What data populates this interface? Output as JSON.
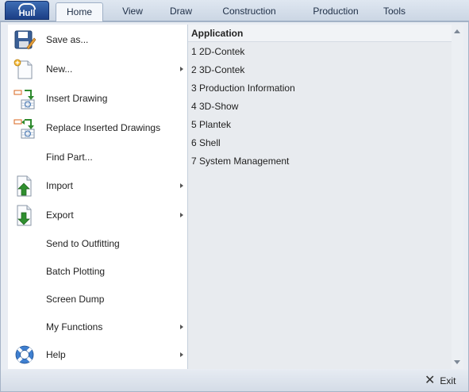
{
  "app_button": {
    "label": "Hull"
  },
  "tabs": [
    {
      "label": "Home"
    },
    {
      "label": "View"
    },
    {
      "label": "Draw"
    },
    {
      "label": "Construction"
    },
    {
      "label": "Production"
    },
    {
      "label": "Tools"
    }
  ],
  "menu": {
    "items": [
      {
        "label": "Save as...",
        "icon": "save-as-icon",
        "submenu": false
      },
      {
        "label": "New...",
        "icon": "new-document-icon",
        "submenu": true
      },
      {
        "label": "Insert Drawing",
        "icon": "insert-drawing-icon",
        "submenu": false
      },
      {
        "label": "Replace Inserted Drawings",
        "icon": "replace-drawings-icon",
        "submenu": false
      },
      {
        "label": "Find Part...",
        "icon": "",
        "submenu": false
      },
      {
        "label": "Import",
        "icon": "import-icon",
        "submenu": true
      },
      {
        "label": "Export",
        "icon": "export-icon",
        "submenu": true
      },
      {
        "label": "Send to Outfitting",
        "icon": "",
        "submenu": false
      },
      {
        "label": "Batch Plotting",
        "icon": "",
        "submenu": false
      },
      {
        "label": "Screen Dump",
        "icon": "",
        "submenu": false
      },
      {
        "label": "My Functions",
        "icon": "",
        "submenu": true
      },
      {
        "label": "Help",
        "icon": "help-lifebuoy-icon",
        "submenu": true
      }
    ]
  },
  "applications": {
    "header": "Application",
    "items": [
      "1  2D-Contek",
      "2  3D-Contek",
      "3  Production Information",
      "4  3D-Show",
      "5  Plantek",
      "6  Shell",
      "7  System Management"
    ]
  },
  "footer": {
    "exit_label": "Exit"
  },
  "colors": {
    "app_button": "#1b3f86",
    "menu_background": "#ffffff",
    "pane_background": "#e8ebef",
    "frame": "#a6b4c7"
  }
}
